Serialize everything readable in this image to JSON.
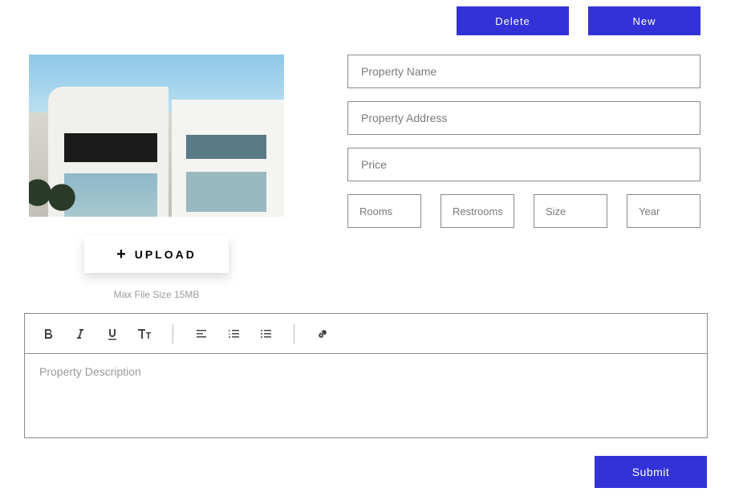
{
  "top": {
    "delete_label": "Delete",
    "new_label": "New"
  },
  "upload": {
    "label": "UPLOAD",
    "hint": "Max File Size 15MB"
  },
  "fields": {
    "name_placeholder": "Property Name",
    "address_placeholder": "Property Address",
    "price_placeholder": "Price",
    "rooms_placeholder": "Rooms",
    "restrooms_placeholder": "Restrooms",
    "size_placeholder": "Size",
    "year_placeholder": "Year"
  },
  "editor": {
    "placeholder": "Property Description"
  },
  "submit_label": "Submit",
  "icons": {
    "bold": "bold-icon",
    "italic": "italic-icon",
    "underline": "underline-icon",
    "textstyle": "textstyle-icon",
    "align": "align-icon",
    "olist": "ordered-list-icon",
    "ulist": "unordered-list-icon",
    "link": "link-icon"
  }
}
